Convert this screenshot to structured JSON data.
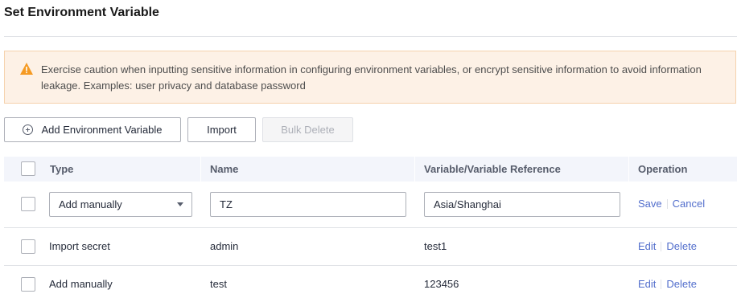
{
  "page": {
    "title": "Set Environment Variable"
  },
  "alert": {
    "icon": "warning-icon",
    "color": "#f59a23",
    "message": "Exercise caution when inputting sensitive information in configuring environment variables, or encrypt sensitive information to avoid information leakage. Examples: user privacy and database password"
  },
  "toolbar": {
    "add_label": "Add Environment Variable",
    "import_label": "Import",
    "bulk_delete_label": "Bulk Delete"
  },
  "table": {
    "headers": {
      "type": "Type",
      "name": "Name",
      "value": "Variable/Variable Reference",
      "operation": "Operation"
    },
    "edit_row": {
      "type": "Add manually",
      "name": "TZ",
      "value": "Asia/Shanghai",
      "save": "Save",
      "cancel": "Cancel"
    },
    "rows": [
      {
        "type": "Import secret",
        "name": "admin",
        "value": "test1",
        "edit": "Edit",
        "delete": "Delete"
      },
      {
        "type": "Add manually",
        "name": "test",
        "value": "123456",
        "edit": "Edit",
        "delete": "Delete"
      }
    ]
  },
  "colors": {
    "link": "#526ecc",
    "alert_bg": "#fdf1e6"
  }
}
